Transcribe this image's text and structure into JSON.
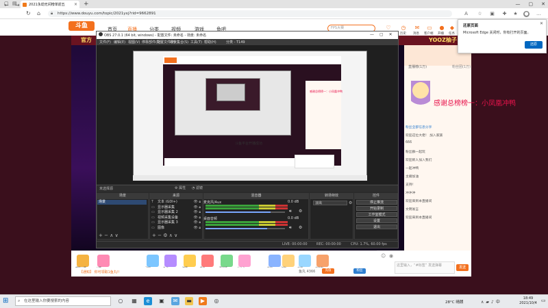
{
  "browser": {
    "tab_title": "2021永劫无间榜单前五",
    "url": "https://www.douyu.com/topic/2021yxj?rid=9662891"
  },
  "site": {
    "logo": "斗鱼",
    "nav": [
      "首页",
      "直播",
      "分类",
      "视频",
      "游戏",
      "鱼吧"
    ],
    "search_placeholder": "FPS大赛",
    "header_icons": [
      "关注",
      "历史",
      "消息",
      "客户端",
      "开播",
      "任务"
    ],
    "banner_left": "官方",
    "banner_right": "YOOZ柚子"
  },
  "chat": {
    "tabs": [
      "直播榜(1万)",
      "粉丝团(1万)"
    ],
    "thanks": "感谢总榜榜一：小凤凰冲鸭",
    "lines": [
      {
        "name": "粉丝全部信息分享",
        "text": ""
      },
      {
        "name": "",
        "text": "欢迎这位大佬！ 加入家族"
      },
      {
        "name": "",
        "text": "666"
      },
      {
        "name": "",
        "text": "粉丝群一起玩"
      },
      {
        "name": "",
        "text": "欢迎新人加入我们"
      },
      {
        "name": "",
        "text": "一起冲鸭"
      },
      {
        "name": "",
        "text": "主播加油"
      },
      {
        "name": "",
        "text": "支持！"
      },
      {
        "name": "",
        "text": "冲冲冲"
      },
      {
        "name": "",
        "text": "欢迎来到本直播间"
      },
      {
        "name": "",
        "text": "文明发言"
      },
      {
        "name": "",
        "text": "欢迎来到本直播间"
      }
    ]
  },
  "gifts": [
    "超级火箭",
    "火箭",
    "飞机",
    "办卡",
    "弹幕",
    "鱼丸",
    "荧光棒",
    "小心心",
    "告白",
    "送你",
    "大佬",
    "大红包"
  ],
  "gift_bar": {
    "notice": "【通知】 你可领取1鱼丸!!",
    "fishball": "鱼丸 4366",
    "charge": "充值",
    "other": "粉丝",
    "chat_placeholder": "这里输入，“#标签” 发送弹幕",
    "send": "发送"
  },
  "obs": {
    "title": "OBS 27.0.1 (64 bit, windows) - 配置文件: 未命名 - 场景: 未命名",
    "menu": [
      "文件(F)",
      "编辑(E)",
      "视图(V)",
      "停靠部件(D)",
      "配置文件(P)",
      "场景集合(S)",
      "工具(T)",
      "帮助(H)",
      "分类 - T149"
    ],
    "preview_label": "斗鱼平台开播成功",
    "preview_side_text": "感谢总榜榜一：小凤凰冲鸭",
    "no_source": "未选择源",
    "properties": "属性",
    "filters": "滤镜",
    "docks": {
      "scenes": "场景",
      "sources": "来源",
      "mixer": "混音器",
      "transitions": "转场特效",
      "controls": "控件"
    },
    "scene_item": "场景",
    "sources": [
      {
        "icon": "T",
        "name": "文本 (GDI+)"
      },
      {
        "icon": "▭",
        "name": "显示器采集"
      },
      {
        "icon": "▭",
        "name": "显示器采集 2"
      },
      {
        "icon": "▭",
        "name": "视频采集设备"
      },
      {
        "icon": "▭",
        "name": "显示器采集 3"
      },
      {
        "icon": "▭",
        "name": "图像"
      }
    ],
    "mixer": [
      {
        "name": "麦克风/Aux",
        "db": "0.0 dB",
        "level": 0.82
      },
      {
        "name": "桌面音频",
        "db": "0.0 dB",
        "level": 0.78
      }
    ],
    "transition": "淡出",
    "controls": [
      "停止推流",
      "开始录制",
      "工作室模式",
      "设置",
      "退出"
    ],
    "status": {
      "live": "LIVE: 00:00:00",
      "rec": "REC: 00:00:00",
      "cpu": "CPU: 1.7%, 60.00 fps"
    }
  },
  "edge_popup": {
    "title": "还原页面",
    "body": "Microsoft Edge 关闭时，你有打开的页面。",
    "button": "还原"
  },
  "taskbar": {
    "search_placeholder": "在这里输入你要搜索的内容",
    "weather": "28°C 晴朗",
    "time": "18:49",
    "date": "2021/10/4"
  },
  "colors": {
    "brand": "#f3701e",
    "thanks": "#e8134b",
    "edge_blue": "#0067c0",
    "obs_bg": "#2b2b2b"
  }
}
